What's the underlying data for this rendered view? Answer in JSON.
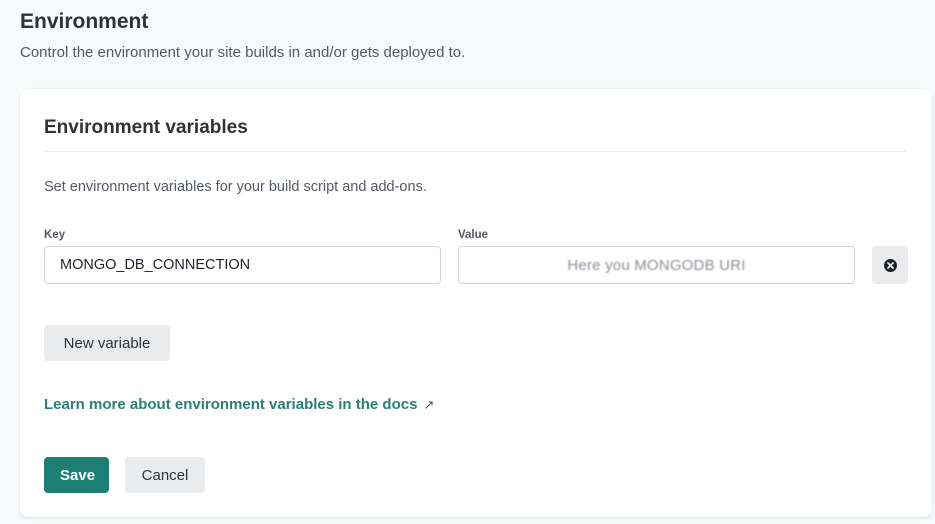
{
  "section": {
    "title": "Environment",
    "description": "Control the environment your site builds in and/or gets deployed to."
  },
  "card": {
    "title": "Environment variables",
    "description": "Set environment variables for your build script and add-ons."
  },
  "variable": {
    "key_label": "Key",
    "key_value": "MONGO_DB_CONNECTION",
    "value_label": "Value",
    "value_text": "Here you MONGODB URI",
    "remove_icon": "close-circle-icon"
  },
  "actions": {
    "new_variable": "New variable",
    "docs_link": "Learn more about environment variables in the docs",
    "docs_link_arrow": "↗",
    "save": "Save",
    "cancel": "Cancel"
  },
  "colors": {
    "accent": "#1d7f73",
    "link": "#2a7f75",
    "page_background": "#f6fafb",
    "button_secondary": "#e9ebed"
  }
}
